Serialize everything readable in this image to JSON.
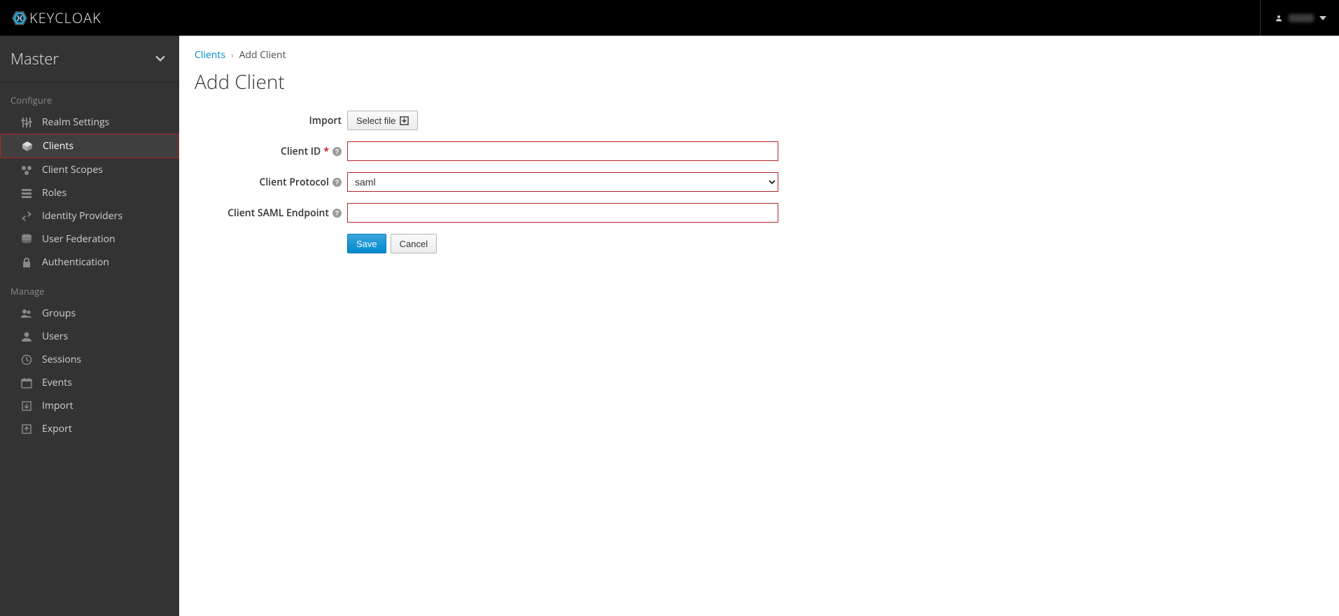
{
  "brand": {
    "name": "KEYCLOAK"
  },
  "topbar": {
    "user_indicator": "▾"
  },
  "realm": {
    "selected": "Master"
  },
  "sidebar": {
    "sections": {
      "configure": {
        "header": "Configure",
        "items": [
          {
            "label": "Realm Settings"
          },
          {
            "label": "Clients"
          },
          {
            "label": "Client Scopes"
          },
          {
            "label": "Roles"
          },
          {
            "label": "Identity Providers"
          },
          {
            "label": "User Federation"
          },
          {
            "label": "Authentication"
          }
        ]
      },
      "manage": {
        "header": "Manage",
        "items": [
          {
            "label": "Groups"
          },
          {
            "label": "Users"
          },
          {
            "label": "Sessions"
          },
          {
            "label": "Events"
          },
          {
            "label": "Import"
          },
          {
            "label": "Export"
          }
        ]
      }
    }
  },
  "breadcrumb": {
    "link": "Clients",
    "current": "Add Client"
  },
  "page": {
    "title": "Add Client"
  },
  "form": {
    "import_label": "Import",
    "select_file_label": "Select file",
    "client_id_label": "Client ID",
    "client_id_value": "",
    "client_protocol_label": "Client Protocol",
    "client_protocol_value": "saml",
    "client_saml_endpoint_label": "Client SAML Endpoint",
    "client_saml_endpoint_value": "",
    "save_label": "Save",
    "cancel_label": "Cancel"
  }
}
